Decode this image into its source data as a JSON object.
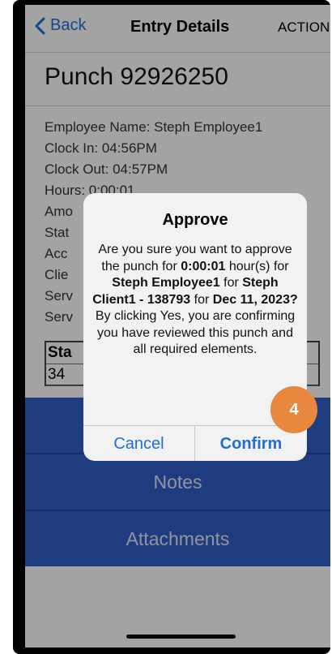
{
  "navbar": {
    "back_label": "Back",
    "title": "Entry Details",
    "action_label": "ACTION",
    "accent_color": "#1f6fd1"
  },
  "punch": {
    "title": "Punch 92926250",
    "fields": [
      "Employee Name: Steph Employee1",
      "Clock In: 04:56PM",
      "Clock Out: 04:57PM",
      "Hours: 0:00:01",
      "Amo",
      "Stat",
      "Acc",
      "Clie",
      "Serv",
      "Serv"
    ]
  },
  "mini_table": {
    "header": "Sta",
    "value": "34"
  },
  "buttons": {
    "notes_label": "Notes",
    "attachments_label": "Attachments",
    "color": "#2f5fc7"
  },
  "dialog": {
    "title": "Approve",
    "msg_1": "Are you sure you want to approve the punch for ",
    "hours": "0:00:01",
    "msg_2": " hour(s) for ",
    "employee": "Steph Employee1",
    "msg_3": " for ",
    "client": "Steph Client1 - 138793",
    "msg_4": " for ",
    "date": "Dec 11, 2023?",
    "msg_5": " By clicking Yes, you are confirming you have reviewed this punch and all required elements.",
    "cancel_label": "Cancel",
    "confirm_label": "Confirm"
  },
  "step_badge": {
    "number": "4",
    "color": "#e8883e"
  }
}
